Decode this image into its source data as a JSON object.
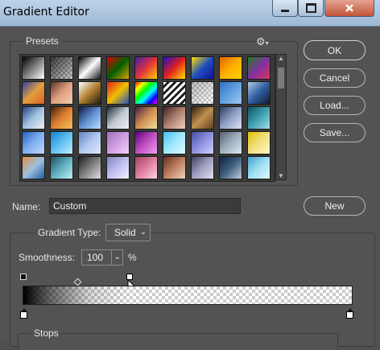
{
  "window": {
    "title": "Gradient Editor"
  },
  "presets": {
    "label": "Presets",
    "rows": [
      [
        [
          "#000000",
          "#ffffff"
        ],
        "checker-dark",
        [
          "#000000",
          "#ffffff",
          "#111111"
        ],
        [
          "#e00000",
          "#006000",
          "#e0a000"
        ],
        [
          "#4020a0",
          "#e03040",
          "#ffd000"
        ],
        [
          "#2010c0",
          "#e02020",
          "#ffe000"
        ],
        [
          "#ffe000",
          "#2050c0",
          "#101090"
        ],
        [
          "#e06000",
          "#ffb000",
          "#ffd000"
        ],
        [
          "#208020",
          "#8030a0",
          "#e03060"
        ]
      ],
      [
        [
          "#3040a0",
          "#e0a040",
          "#e06020"
        ],
        [
          "#5a3020",
          "#e0a080",
          "#f0d0b0"
        ],
        [
          "#ffffff",
          "#b08030",
          "#201a10"
        ],
        [
          "#e02020",
          "#f0c000",
          "#2050c0"
        ],
        [
          "#ff0000",
          "#ffff00",
          "#00ff00",
          "#00ffff",
          "#0000ff",
          "#ff00ff"
        ],
        "stripes",
        "checker-light",
        [
          "#3070c0",
          "#60a0e0",
          "#a0c8f0"
        ],
        [
          "#b0c8e0",
          "#3060a0",
          "#101830"
        ]
      ],
      [
        [
          "#204080",
          "#a0c0e0",
          "#f0f0f0"
        ],
        [
          "#402010",
          "#e08030",
          "#f0c060"
        ],
        [
          "#101840",
          "#6090d0",
          "#c0e0ff"
        ],
        [
          "#1a2a3a",
          "#c0c8d0",
          "#f0f0f0"
        ],
        [
          "#40204a",
          "#d09050",
          "#f0e0a0"
        ],
        [
          "#402020",
          "#b08070",
          "#f0d0c0"
        ],
        [
          "#302010",
          "#c09050",
          "#604020"
        ],
        [
          "#303a60",
          "#90a0c8",
          "#e0e4f0"
        ],
        [
          "#105060",
          "#40a0b0",
          "#a0e0e8"
        ]
      ],
      [
        [
          "#2060c0",
          "#80b0f0",
          "#c0d8ff"
        ],
        [
          "#1080d0",
          "#60c0f0",
          "#c0f0ff"
        ],
        [
          "#6080c0",
          "#b0c8f0",
          "#e0e8ff"
        ],
        [
          "#a070c0",
          "#d0a0e0",
          "#f0d0ff"
        ],
        [
          "#600080",
          "#c050c0",
          "#f0a0f0"
        ],
        [
          "#40c0f0",
          "#a0e8ff",
          "#e0f8ff"
        ],
        [
          "#4050a0",
          "#9090e0",
          "#d0d0ff"
        ],
        [
          "#506070",
          "#a0b0c0",
          "#e0e8f0"
        ],
        [
          "#e0c000",
          "#f0e080",
          "#fff8c0"
        ]
      ],
      [
        [
          "#e09040",
          "#a0c0e0",
          "#2060a0"
        ],
        [
          "#205060",
          "#60b0c0",
          "#c0f0f0"
        ],
        [
          "#202020",
          "#808080",
          "#e0e0e0"
        ],
        [
          "#8080c0",
          "#c0c0f0",
          "#f0f0ff"
        ],
        [
          "#a04060",
          "#e080a0",
          "#ffd0e0"
        ],
        [
          "#603020",
          "#c08060",
          "#f0d0c0"
        ],
        [
          "#404060",
          "#a0a0c0",
          "#e0e0f0"
        ],
        [
          "#102040",
          "#406080",
          "#c0d0e0"
        ],
        [
          "#40a0d0",
          "#a0e0f0",
          "#e0f8ff"
        ]
      ]
    ]
  },
  "buttons": {
    "ok": "OK",
    "cancel": "Cancel",
    "load": "Load...",
    "save": "Save...",
    "new": "New"
  },
  "name_field": {
    "label": "Name:",
    "value": "Custom"
  },
  "gradient": {
    "type_label": "Gradient Type:",
    "type_value": "Solid",
    "smoothness_label": "Smoothness:",
    "smoothness_value": "100",
    "smoothness_unit": "%"
  },
  "stops": {
    "label": "Stops"
  },
  "icons": {
    "gear": "gear-icon",
    "cursor": "pointer-cursor-icon",
    "minimize": "minimize-icon",
    "maximize": "maximize-icon",
    "close": "close-icon"
  }
}
